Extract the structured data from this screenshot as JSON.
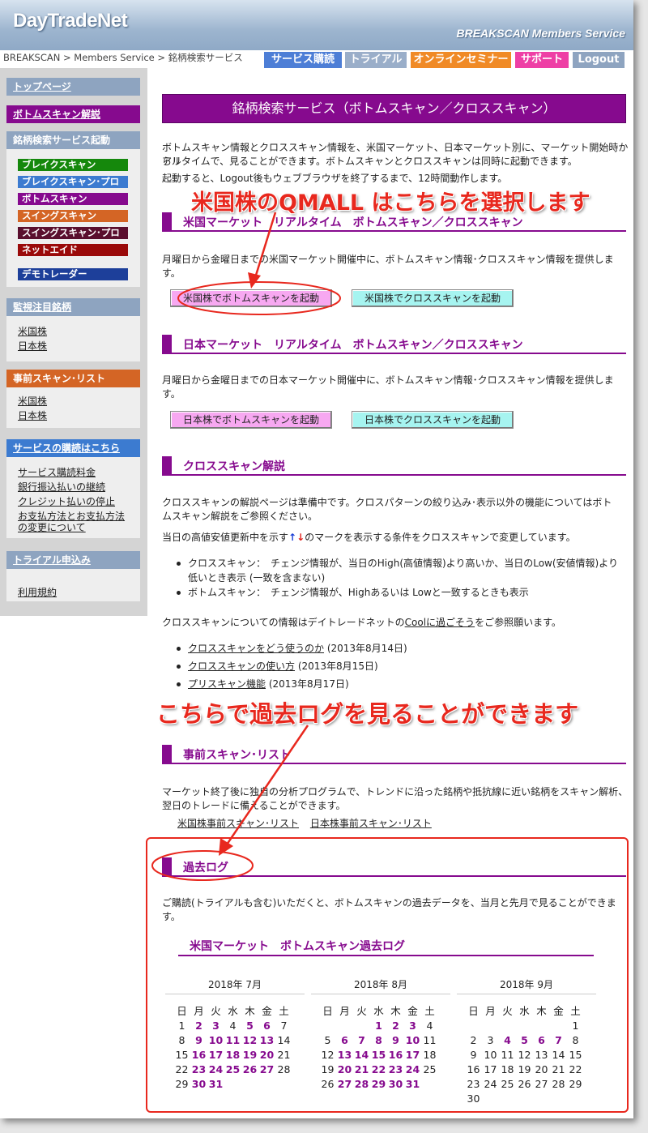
{
  "header": {
    "logo": "DayTradeNet",
    "service": "BREAKSCAN Members Service"
  },
  "breadcrumb": "BREAKSCAN > Members Service > 銘柄検索サービス",
  "nav": [
    {
      "label": "サービス購読",
      "color": "#4d7ed6"
    },
    {
      "label": "トライアル",
      "color": "#9aaec9"
    },
    {
      "label": "オンラインセミナー",
      "color": "#f08a26"
    },
    {
      "label": "サポート",
      "color": "#ee3fa5"
    },
    {
      "label": "Logout",
      "color": "#8ea4c0"
    }
  ],
  "sidebar": {
    "top": "トップページ",
    "bottomscan": "ボトムスキャン解説",
    "launch_head": "銘柄検索サービス起動",
    "launch": [
      {
        "label": "ブレイクスキャン",
        "color": "#15880c"
      },
      {
        "label": "ブレイクスキャン･プロ",
        "color": "#3c7bd0"
      },
      {
        "label": "ボトムスキャン",
        "color": "#860a8e"
      },
      {
        "label": "スイングスキャン",
        "color": "#d46525"
      },
      {
        "label": "スイングスキャン･プロ",
        "color": "#5a0f2e"
      },
      {
        "label": "ネットエイド",
        "color": "#9a0a0a"
      }
    ],
    "demo": "デモトレーダー",
    "watch_head": "監視注目銘柄",
    "watch": [
      "米国株",
      "日本株"
    ],
    "prescan_head": "事前スキャン･リスト",
    "prescan": [
      "米国株",
      "日本株"
    ],
    "subscribe_head": "サービスの購読はこちら",
    "subscribe": [
      "サービス購読料金",
      "銀行振込払いの継続",
      "クレジット払いの停止",
      "お支払方法とお支払方法",
      "の変更について"
    ],
    "trial_head": "トライアル申込み",
    "terms": "利用規約"
  },
  "main": {
    "title": "銘柄検索サービス（ボトムスキャン／クロススキャン）",
    "intro1": "ボトムスキャン情報とクロススキャン情報を、米国マーケット、日本マーケット別に、マーケット開始時からリ",
    "intro2": "アルタイムで、見ることができます。ボトムスキャンとクロススキャンは同時に起動できます。",
    "intro3": "起動すると、Logout後もウェブブラウザを終了するまで、12時間動作します。",
    "annot1": "米国株のQMALL はこちらを選択します",
    "us_head": "米国マーケット　リアルタイム　ボトムスキャン／クロススキャン",
    "us_desc1": "月曜日から金曜日までの米国マーケット開催中に、ボトムスキャン情報･クロススキャン情報を提供しま",
    "us_desc2": "す。",
    "us_btn_bottom": "米国株でボトムスキャンを起動",
    "us_btn_cross": "米国株でクロススキャンを起動",
    "jp_head": "日本マーケット　リアルタイム　ボトムスキャン／クロススキャン",
    "jp_desc1": "月曜日から金曜日までの日本マーケット開催中に、ボトムスキャン情報･クロススキャン情報を提供しま",
    "jp_desc2": "す。",
    "jp_btn_bottom": "日本株でボトムスキャンを起動",
    "jp_btn_cross": "日本株でクロススキャンを起動",
    "cross_head": "クロススキャン解説",
    "cross_p1a": "クロススキャンの解説ページは準備中です。クロスパターンの絞り込み･表示以外の機能についてはボト",
    "cross_p1b": "ムスキャン解説をご参照ください。",
    "cross_p2a": "当日の高値安値更新中を示す",
    "cross_p2b": "のマークを表示する条件をクロススキャンで変更しています。",
    "cross_li1a": "クロススキャン：　チェンジ情報が、当日のHigh(高値情報)より高いか、当日のLow(安値情報)より",
    "cross_li1b": "低いとき表示 (一致を含まない)",
    "cross_li2": "ボトムスキャン：　チェンジ情報が、Highあるいは Lowと一致するときも表示",
    "cross_p3a": "クロススキャンについての情報はデイトレードネットの",
    "cross_p3link": "Coolに過ごそう",
    "cross_p3b": "をご参照願います。",
    "links": [
      {
        "text": "クロススキャンをどう使うのか",
        "date": " (2013年8月14日)"
      },
      {
        "text": "クロススキャンの使い方",
        "date": " (2013年8月15日)"
      },
      {
        "text": "プリスキャン機能",
        "date": " (2013年8月17日)"
      }
    ],
    "annot2": "こちらで過去ログを見ることができます",
    "pre_head": "事前スキャン･リスト",
    "pre_desc1": "マーケット終了後に独自の分析プログラムで、トレンドに沿った銘柄や抵抗線に近い銘柄をスキャン解析、",
    "pre_desc2": "翌日のトレードに備えることができます。",
    "pre_link_us": "米国株事前スキャン･リスト",
    "pre_link_jp": "日本株事前スキャン･リスト",
    "log_head": "過去ログ",
    "log_desc": "ご購読(トライアルも含む)いただくと、ボトムスキャンの過去データを、当月と先月で見ることができます。",
    "log_sub": "米国マーケット　ボトムスキャン過去ログ"
  },
  "calendar": {
    "weekdays": [
      "日",
      "月",
      "火",
      "水",
      "木",
      "金",
      "土"
    ],
    "months": [
      {
        "title": "2018年 7月",
        "offset": 0,
        "days": 31,
        "links": [
          2,
          3,
          5,
          6,
          9,
          10,
          11,
          12,
          13,
          16,
          17,
          18,
          19,
          20,
          23,
          24,
          25,
          26,
          27,
          30,
          31
        ]
      },
      {
        "title": "2018年 8月",
        "offset": 3,
        "days": 31,
        "links": [
          1,
          2,
          3,
          6,
          7,
          8,
          9,
          10,
          13,
          14,
          15,
          16,
          17,
          20,
          21,
          22,
          23,
          24,
          27,
          28,
          29,
          30,
          31
        ]
      },
      {
        "title": "2018年 9月",
        "offset": 6,
        "days": 30,
        "links": [
          4,
          5,
          6,
          7
        ]
      }
    ]
  }
}
